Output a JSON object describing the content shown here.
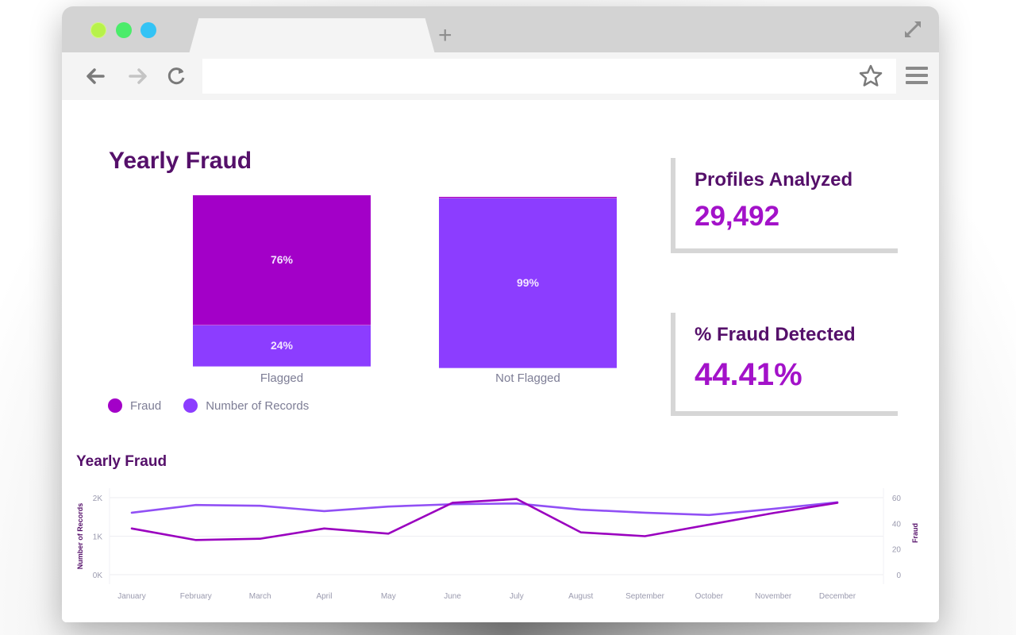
{
  "browser": {
    "tab_title": "",
    "address_value": "",
    "new_tab_icon": "plus-icon",
    "icons": [
      "back-arrow-icon",
      "forward-arrow-icon",
      "reload-icon",
      "star-icon",
      "hamburger-menu-icon",
      "expand-icon"
    ]
  },
  "colors": {
    "fraud": "#a300c8",
    "records": "#8c3dff",
    "title": "#55106a",
    "kpi_value": "#a312c9",
    "axis_text": "#9a9aae"
  },
  "dashboard": {
    "bar_title": "Yearly Fraud",
    "line_title": "Yearly Fraud",
    "kpis": [
      {
        "label": "Profiles Analyzed",
        "value": "29,492"
      },
      {
        "label": "% Fraud Detected",
        "value": "44.41%"
      }
    ],
    "legend": [
      {
        "label": "Fraud",
        "color": "#a300c8"
      },
      {
        "label": "Number of Records",
        "color": "#8c3dff"
      }
    ]
  },
  "chart_data": [
    {
      "type": "bar",
      "stacked": true,
      "normalized": true,
      "title": "Yearly Fraud",
      "categories": [
        "Flagged",
        "Not Flagged"
      ],
      "series": [
        {
          "name": "Fraud",
          "values": [
            76,
            1
          ],
          "labels": [
            "76%",
            ""
          ]
        },
        {
          "name": "Number of Records",
          "values": [
            24,
            99
          ],
          "labels": [
            "24%",
            "99%"
          ]
        }
      ],
      "legend": "bottom-left",
      "ylim": [
        0,
        100
      ]
    },
    {
      "type": "line",
      "title": "Yearly Fraud",
      "x": [
        "January",
        "February",
        "March",
        "April",
        "May",
        "June",
        "July",
        "August",
        "September",
        "October",
        "November",
        "December"
      ],
      "series": [
        {
          "name": "Number of Records",
          "axis": "left",
          "values": [
            1610,
            1810,
            1790,
            1650,
            1770,
            1830,
            1850,
            1690,
            1610,
            1550,
            1710,
            1880
          ]
        },
        {
          "name": "Fraud",
          "axis": "right",
          "values": [
            36,
            27,
            28,
            36,
            32,
            56,
            59,
            33,
            30,
            39,
            48,
            56
          ]
        }
      ],
      "ylabel": "Number of Records",
      "ylabel_right": "Fraud",
      "ylim": [
        0,
        2000
      ],
      "ylim_right": [
        0,
        60
      ],
      "yticks": [
        "0K",
        "1K",
        "2K"
      ],
      "yticks_right": [
        "0",
        "20",
        "40",
        "60"
      ],
      "grid": true
    }
  ]
}
